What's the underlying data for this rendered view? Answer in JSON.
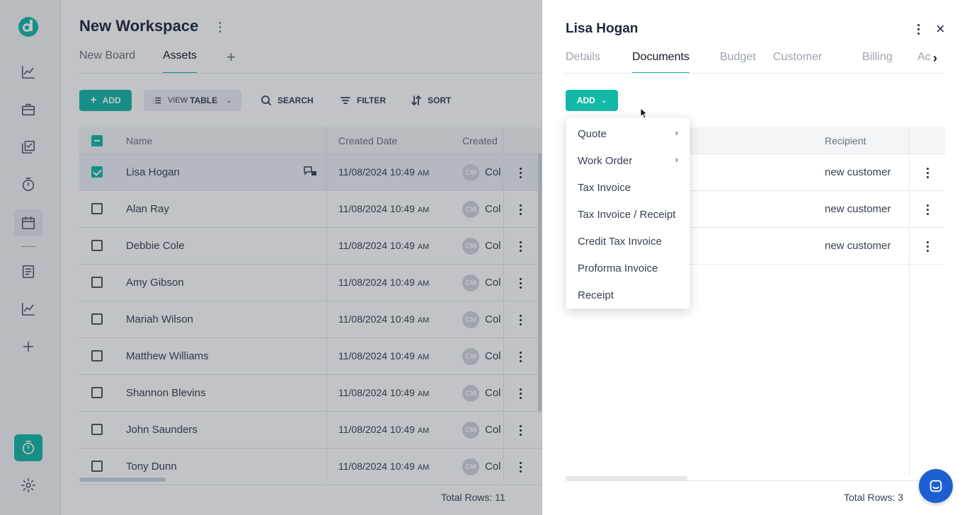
{
  "colors": {
    "accent": "#14b8a6",
    "fab": "#1d5fd1"
  },
  "rail": {
    "icons": [
      "logo-icon",
      "analytics-icon",
      "briefcase-icon",
      "tasks-icon",
      "timer-icon",
      "calendar-icon",
      "document-icon",
      "chart-icon",
      "plus-icon",
      "stopwatch-icon",
      "settings-icon"
    ]
  },
  "workspace": {
    "title": "New Workspace",
    "tabs": [
      "New Board",
      "Assets"
    ],
    "active_tab": "Assets"
  },
  "toolbar": {
    "add_label": "ADD",
    "view_label": "VIEW",
    "view_value": "TABLE",
    "search_label": "SEARCH",
    "filter_label": "FILTER",
    "sort_label": "SORT"
  },
  "table": {
    "columns": [
      "Name",
      "Created Date",
      "Created"
    ],
    "rows": [
      {
        "name": "Lisa Hogan",
        "date": "11/08/2024 10:49",
        "ampm": "AM",
        "avatar": "CM",
        "creator": "Col",
        "checked": true
      },
      {
        "name": "Alan Ray",
        "date": "11/08/2024 10:49",
        "ampm": "AM",
        "avatar": "CM",
        "creator": "Col",
        "checked": false
      },
      {
        "name": "Debbie Cole",
        "date": "11/08/2024 10:49",
        "ampm": "AM",
        "avatar": "CM",
        "creator": "Col",
        "checked": false
      },
      {
        "name": "Amy Gibson",
        "date": "11/08/2024 10:49",
        "ampm": "AM",
        "avatar": "CM",
        "creator": "Col",
        "checked": false
      },
      {
        "name": "Mariah Wilson",
        "date": "11/08/2024 10:49",
        "ampm": "AM",
        "avatar": "CM",
        "creator": "Col",
        "checked": false
      },
      {
        "name": "Matthew Williams",
        "date": "11/08/2024 10:49",
        "ampm": "AM",
        "avatar": "CM",
        "creator": "Col",
        "checked": false
      },
      {
        "name": "Shannon Blevins",
        "date": "11/08/2024 10:49",
        "ampm": "AM",
        "avatar": "CM",
        "creator": "Col",
        "checked": false
      },
      {
        "name": "John Saunders",
        "date": "11/08/2024 10:49",
        "ampm": "AM",
        "avatar": "CM",
        "creator": "Col",
        "checked": false
      },
      {
        "name": "Tony Dunn",
        "date": "11/08/2024 10:49",
        "ampm": "AM",
        "avatar": "CM",
        "creator": "Col",
        "checked": false
      }
    ],
    "total": "Total Rows: 11"
  },
  "drawer": {
    "title": "Lisa Hogan",
    "tabs": [
      "Details",
      "Documents",
      "Budget",
      "Customer",
      "Billing",
      "Ac"
    ],
    "active_tab": "Documents",
    "add_label": "ADD",
    "column": "Recipient",
    "rows": [
      {
        "recipient": "new customer"
      },
      {
        "recipient": "new customer"
      },
      {
        "recipient": "new customer"
      }
    ],
    "total": "Total Rows: 3"
  },
  "add_menu": {
    "items": [
      {
        "label": "Quote",
        "submenu": true
      },
      {
        "label": "Work Order",
        "submenu": true
      },
      {
        "label": "Tax Invoice",
        "submenu": false
      },
      {
        "label": "Tax Invoice / Receipt",
        "submenu": false
      },
      {
        "label": "Credit Tax Invoice",
        "submenu": false
      },
      {
        "label": "Proforma Invoice",
        "submenu": false
      },
      {
        "label": "Receipt",
        "submenu": false
      }
    ]
  }
}
